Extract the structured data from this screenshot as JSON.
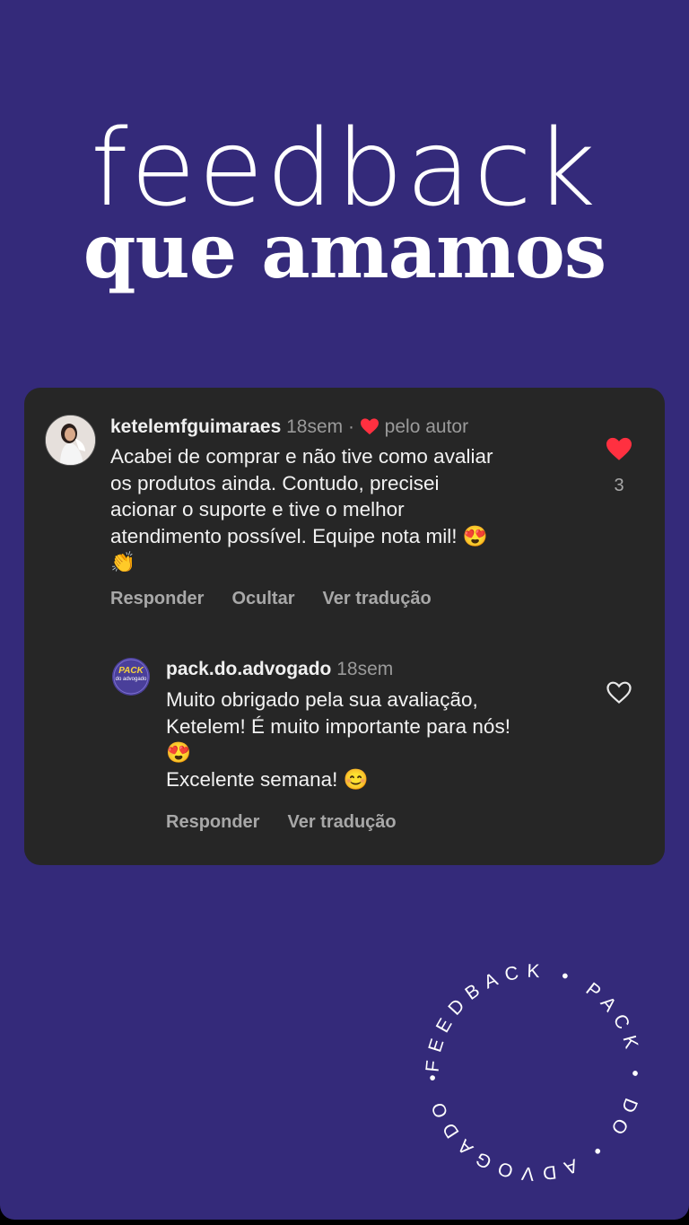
{
  "headline": {
    "line1": "feedback",
    "line2": "que amamos"
  },
  "comment": {
    "username": "ketelemfguimaraes",
    "time": "18sem",
    "separator": "·",
    "liked_by_author": "pelo autor",
    "text": "Acabei de comprar e não tive como avaliar\nos produtos ainda. Contudo, precisei\nacionar o suporte e tive o melhor\natendimento possível. Equipe nota mil! 😍\n👏",
    "like_count": "3",
    "actions": [
      "Responder",
      "Ocultar",
      "Ver tradução"
    ]
  },
  "reply": {
    "username": "pack.do.advogado",
    "time": "18sem",
    "avatar_text_1": "PACK",
    "avatar_text_2": "do advogado",
    "text": "Muito obrigado pela sua avaliação,\nKetelem! É muito importante para nós!\n😍\nExcelente semana! 😊",
    "actions": [
      "Responder",
      "Ver tradução"
    ]
  },
  "stamp": {
    "text": "FEEDBACK • PACK • DO • ADVOGADO •"
  },
  "colors": {
    "background": "#342a7a",
    "card": "#262626",
    "heart": "#ff3040"
  },
  "icons": {
    "liked": "heart-filled-icon",
    "unliked": "heart-outline-icon"
  }
}
